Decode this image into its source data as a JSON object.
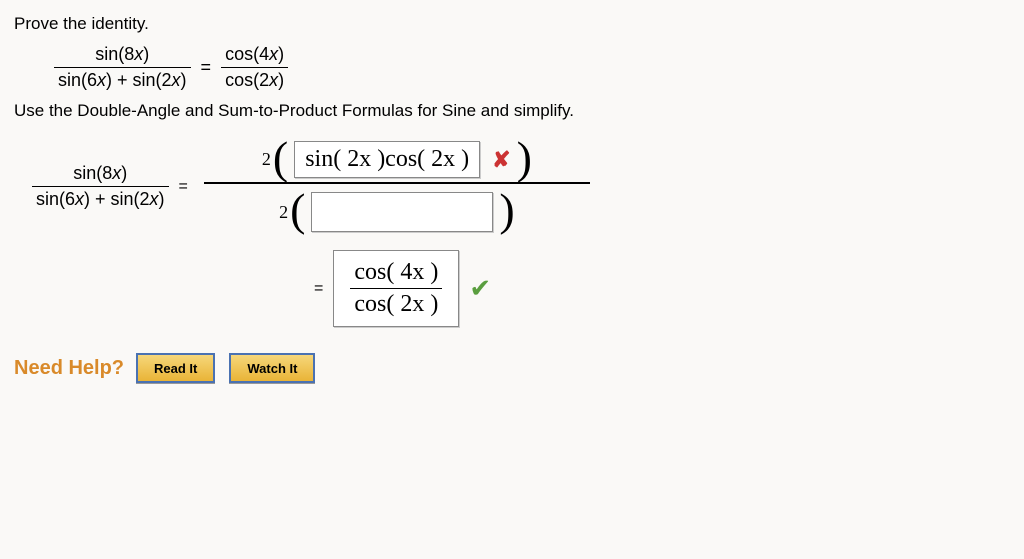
{
  "prompt": "Prove the identity.",
  "identity": {
    "lhs_num": "sin(8x)",
    "lhs_den": "sin(6x) + sin(2x)",
    "rhs_num": "cos(4x)",
    "rhs_den": "cos(2x)"
  },
  "instruction": "Use the Double-Angle and Sum-to-Product Formulas for Sine and simplify.",
  "step1": {
    "lhs_num": "sin(8x)",
    "lhs_den": "sin(6x) + sin(2x)",
    "numerator_prefix": "2",
    "numerator_answer": "sin( 2x )cos( 2x )",
    "numerator_correct": false,
    "denom_prefix": "2",
    "denom_answer": ""
  },
  "final": {
    "top": "cos( 4x )",
    "bot": "cos( 2x )",
    "correct": true
  },
  "help": {
    "label": "Need Help?",
    "read": "Read It",
    "watch": "Watch It"
  }
}
